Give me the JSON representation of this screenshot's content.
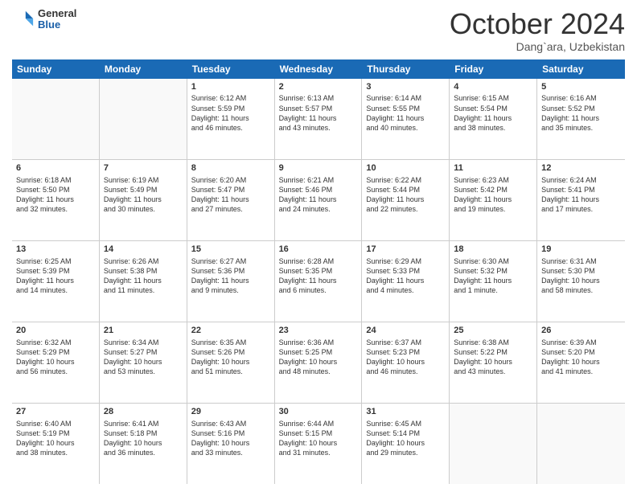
{
  "header": {
    "logo_general": "General",
    "logo_blue": "Blue",
    "month_title": "October 2024",
    "location": "Dang`ara, Uzbekistan"
  },
  "days_of_week": [
    "Sunday",
    "Monday",
    "Tuesday",
    "Wednesday",
    "Thursday",
    "Friday",
    "Saturday"
  ],
  "weeks": [
    [
      {
        "day": "",
        "empty": true
      },
      {
        "day": "",
        "empty": true
      },
      {
        "day": "1",
        "sunrise": "Sunrise: 6:12 AM",
        "sunset": "Sunset: 5:59 PM",
        "daylight": "Daylight: 11 hours and 46 minutes."
      },
      {
        "day": "2",
        "sunrise": "Sunrise: 6:13 AM",
        "sunset": "Sunset: 5:57 PM",
        "daylight": "Daylight: 11 hours and 43 minutes."
      },
      {
        "day": "3",
        "sunrise": "Sunrise: 6:14 AM",
        "sunset": "Sunset: 5:55 PM",
        "daylight": "Daylight: 11 hours and 40 minutes."
      },
      {
        "day": "4",
        "sunrise": "Sunrise: 6:15 AM",
        "sunset": "Sunset: 5:54 PM",
        "daylight": "Daylight: 11 hours and 38 minutes."
      },
      {
        "day": "5",
        "sunrise": "Sunrise: 6:16 AM",
        "sunset": "Sunset: 5:52 PM",
        "daylight": "Daylight: 11 hours and 35 minutes."
      }
    ],
    [
      {
        "day": "6",
        "sunrise": "Sunrise: 6:18 AM",
        "sunset": "Sunset: 5:50 PM",
        "daylight": "Daylight: 11 hours and 32 minutes."
      },
      {
        "day": "7",
        "sunrise": "Sunrise: 6:19 AM",
        "sunset": "Sunset: 5:49 PM",
        "daylight": "Daylight: 11 hours and 30 minutes."
      },
      {
        "day": "8",
        "sunrise": "Sunrise: 6:20 AM",
        "sunset": "Sunset: 5:47 PM",
        "daylight": "Daylight: 11 hours and 27 minutes."
      },
      {
        "day": "9",
        "sunrise": "Sunrise: 6:21 AM",
        "sunset": "Sunset: 5:46 PM",
        "daylight": "Daylight: 11 hours and 24 minutes."
      },
      {
        "day": "10",
        "sunrise": "Sunrise: 6:22 AM",
        "sunset": "Sunset: 5:44 PM",
        "daylight": "Daylight: 11 hours and 22 minutes."
      },
      {
        "day": "11",
        "sunrise": "Sunrise: 6:23 AM",
        "sunset": "Sunset: 5:42 PM",
        "daylight": "Daylight: 11 hours and 19 minutes."
      },
      {
        "day": "12",
        "sunrise": "Sunrise: 6:24 AM",
        "sunset": "Sunset: 5:41 PM",
        "daylight": "Daylight: 11 hours and 17 minutes."
      }
    ],
    [
      {
        "day": "13",
        "sunrise": "Sunrise: 6:25 AM",
        "sunset": "Sunset: 5:39 PM",
        "daylight": "Daylight: 11 hours and 14 minutes."
      },
      {
        "day": "14",
        "sunrise": "Sunrise: 6:26 AM",
        "sunset": "Sunset: 5:38 PM",
        "daylight": "Daylight: 11 hours and 11 minutes."
      },
      {
        "day": "15",
        "sunrise": "Sunrise: 6:27 AM",
        "sunset": "Sunset: 5:36 PM",
        "daylight": "Daylight: 11 hours and 9 minutes."
      },
      {
        "day": "16",
        "sunrise": "Sunrise: 6:28 AM",
        "sunset": "Sunset: 5:35 PM",
        "daylight": "Daylight: 11 hours and 6 minutes."
      },
      {
        "day": "17",
        "sunrise": "Sunrise: 6:29 AM",
        "sunset": "Sunset: 5:33 PM",
        "daylight": "Daylight: 11 hours and 4 minutes."
      },
      {
        "day": "18",
        "sunrise": "Sunrise: 6:30 AM",
        "sunset": "Sunset: 5:32 PM",
        "daylight": "Daylight: 11 hours and 1 minute."
      },
      {
        "day": "19",
        "sunrise": "Sunrise: 6:31 AM",
        "sunset": "Sunset: 5:30 PM",
        "daylight": "Daylight: 10 hours and 58 minutes."
      }
    ],
    [
      {
        "day": "20",
        "sunrise": "Sunrise: 6:32 AM",
        "sunset": "Sunset: 5:29 PM",
        "daylight": "Daylight: 10 hours and 56 minutes."
      },
      {
        "day": "21",
        "sunrise": "Sunrise: 6:34 AM",
        "sunset": "Sunset: 5:27 PM",
        "daylight": "Daylight: 10 hours and 53 minutes."
      },
      {
        "day": "22",
        "sunrise": "Sunrise: 6:35 AM",
        "sunset": "Sunset: 5:26 PM",
        "daylight": "Daylight: 10 hours and 51 minutes."
      },
      {
        "day": "23",
        "sunrise": "Sunrise: 6:36 AM",
        "sunset": "Sunset: 5:25 PM",
        "daylight": "Daylight: 10 hours and 48 minutes."
      },
      {
        "day": "24",
        "sunrise": "Sunrise: 6:37 AM",
        "sunset": "Sunset: 5:23 PM",
        "daylight": "Daylight: 10 hours and 46 minutes."
      },
      {
        "day": "25",
        "sunrise": "Sunrise: 6:38 AM",
        "sunset": "Sunset: 5:22 PM",
        "daylight": "Daylight: 10 hours and 43 minutes."
      },
      {
        "day": "26",
        "sunrise": "Sunrise: 6:39 AM",
        "sunset": "Sunset: 5:20 PM",
        "daylight": "Daylight: 10 hours and 41 minutes."
      }
    ],
    [
      {
        "day": "27",
        "sunrise": "Sunrise: 6:40 AM",
        "sunset": "Sunset: 5:19 PM",
        "daylight": "Daylight: 10 hours and 38 minutes."
      },
      {
        "day": "28",
        "sunrise": "Sunrise: 6:41 AM",
        "sunset": "Sunset: 5:18 PM",
        "daylight": "Daylight: 10 hours and 36 minutes."
      },
      {
        "day": "29",
        "sunrise": "Sunrise: 6:43 AM",
        "sunset": "Sunset: 5:16 PM",
        "daylight": "Daylight: 10 hours and 33 minutes."
      },
      {
        "day": "30",
        "sunrise": "Sunrise: 6:44 AM",
        "sunset": "Sunset: 5:15 PM",
        "daylight": "Daylight: 10 hours and 31 minutes."
      },
      {
        "day": "31",
        "sunrise": "Sunrise: 6:45 AM",
        "sunset": "Sunset: 5:14 PM",
        "daylight": "Daylight: 10 hours and 29 minutes."
      },
      {
        "day": "",
        "empty": true
      },
      {
        "day": "",
        "empty": true
      }
    ]
  ]
}
